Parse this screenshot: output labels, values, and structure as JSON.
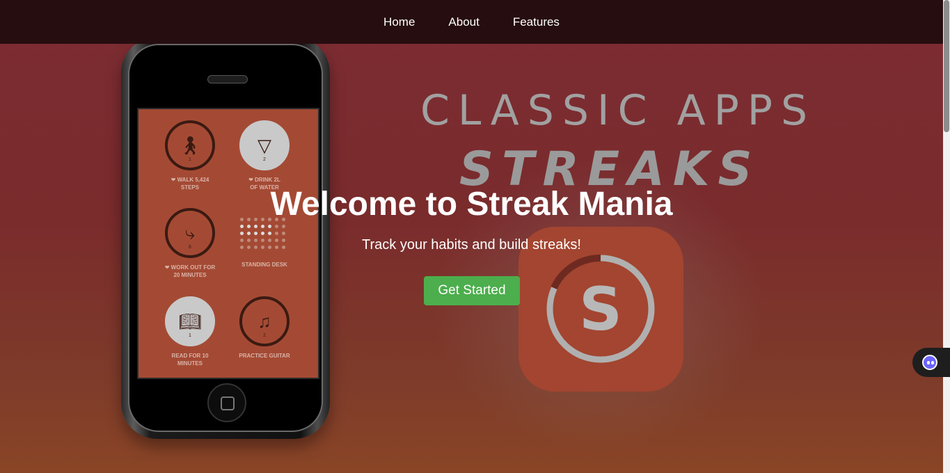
{
  "nav": {
    "items": [
      {
        "label": "Home"
      },
      {
        "label": "About"
      },
      {
        "label": "Features"
      }
    ]
  },
  "hero": {
    "background_art": {
      "title_line1": "CLASSIC APPS",
      "title_line2": "STREAKS",
      "app_icon_letter": "S"
    },
    "heading": "Welcome to Streak Mania",
    "subheading": "Track your habits and build streaks!",
    "cta_label": "Get Started"
  },
  "phone": {
    "habits": [
      {
        "label_line1": "❤ WALK 5,424",
        "label_line2": "STEPS",
        "count": "1"
      },
      {
        "label_line1": "❤ DRINK 2L",
        "label_line2": "OF WATER",
        "count": "2"
      },
      {
        "label_line1": "❤ WORK OUT FOR",
        "label_line2": "20 MINUTES",
        "count": "6"
      },
      {
        "label_line1": "STANDING DESK",
        "label_line2": "",
        "count": ""
      },
      {
        "label_line1": "READ FOR 10",
        "label_line2": "MINUTES",
        "count": "1"
      },
      {
        "label_line1": "PRACTICE GUITAR",
        "label_line2": "",
        "count": "2"
      }
    ]
  },
  "colors": {
    "nav_bg": "#260d0f",
    "cta_bg": "#4cae4c",
    "hero_text": "#ffffff"
  },
  "icons": {
    "widget": "assistant-face-icon"
  }
}
